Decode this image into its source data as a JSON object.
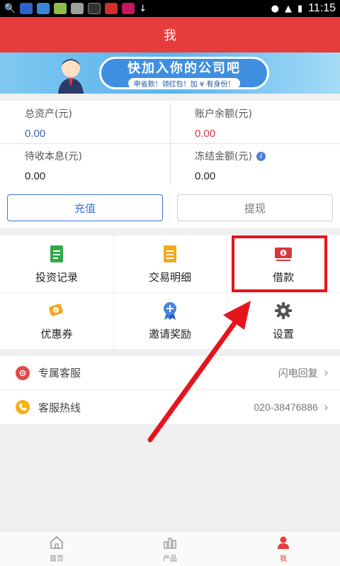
{
  "status_bar": {
    "time": "11:15"
  },
  "header": {
    "title": "我"
  },
  "banner": {
    "headline": "快加入你的公司吧",
    "subline": "申省款！领红包！加 ¥ 有身份！"
  },
  "assets": {
    "total_assets_label": "总资产(元)",
    "total_assets_value": "0.00",
    "balance_label": "账户余额(元)",
    "balance_value": "0.00",
    "pending_label": "待收本息(元)",
    "pending_value": "0.00",
    "frozen_label": "冻结金额(元)",
    "frozen_value": "0.00"
  },
  "actions": {
    "recharge": "充值",
    "withdraw": "提现"
  },
  "grid": {
    "invest_records": "投资记录",
    "transaction_details": "交易明细",
    "loan": "借款",
    "coupons": "优惠券",
    "invite_rewards": "邀请奖励",
    "settings": "设置"
  },
  "service": {
    "exclusive_label": "专属客服",
    "exclusive_value": "闪电回复",
    "hotline_label": "客服热线",
    "hotline_value": "020-38476886"
  },
  "tabbar": {
    "home": "首页",
    "products": "产品",
    "me": "我"
  },
  "colors": {
    "brand_red": "#e63c3c",
    "accent_blue": "#3b73d6",
    "highlight_red": "#e4161c"
  }
}
